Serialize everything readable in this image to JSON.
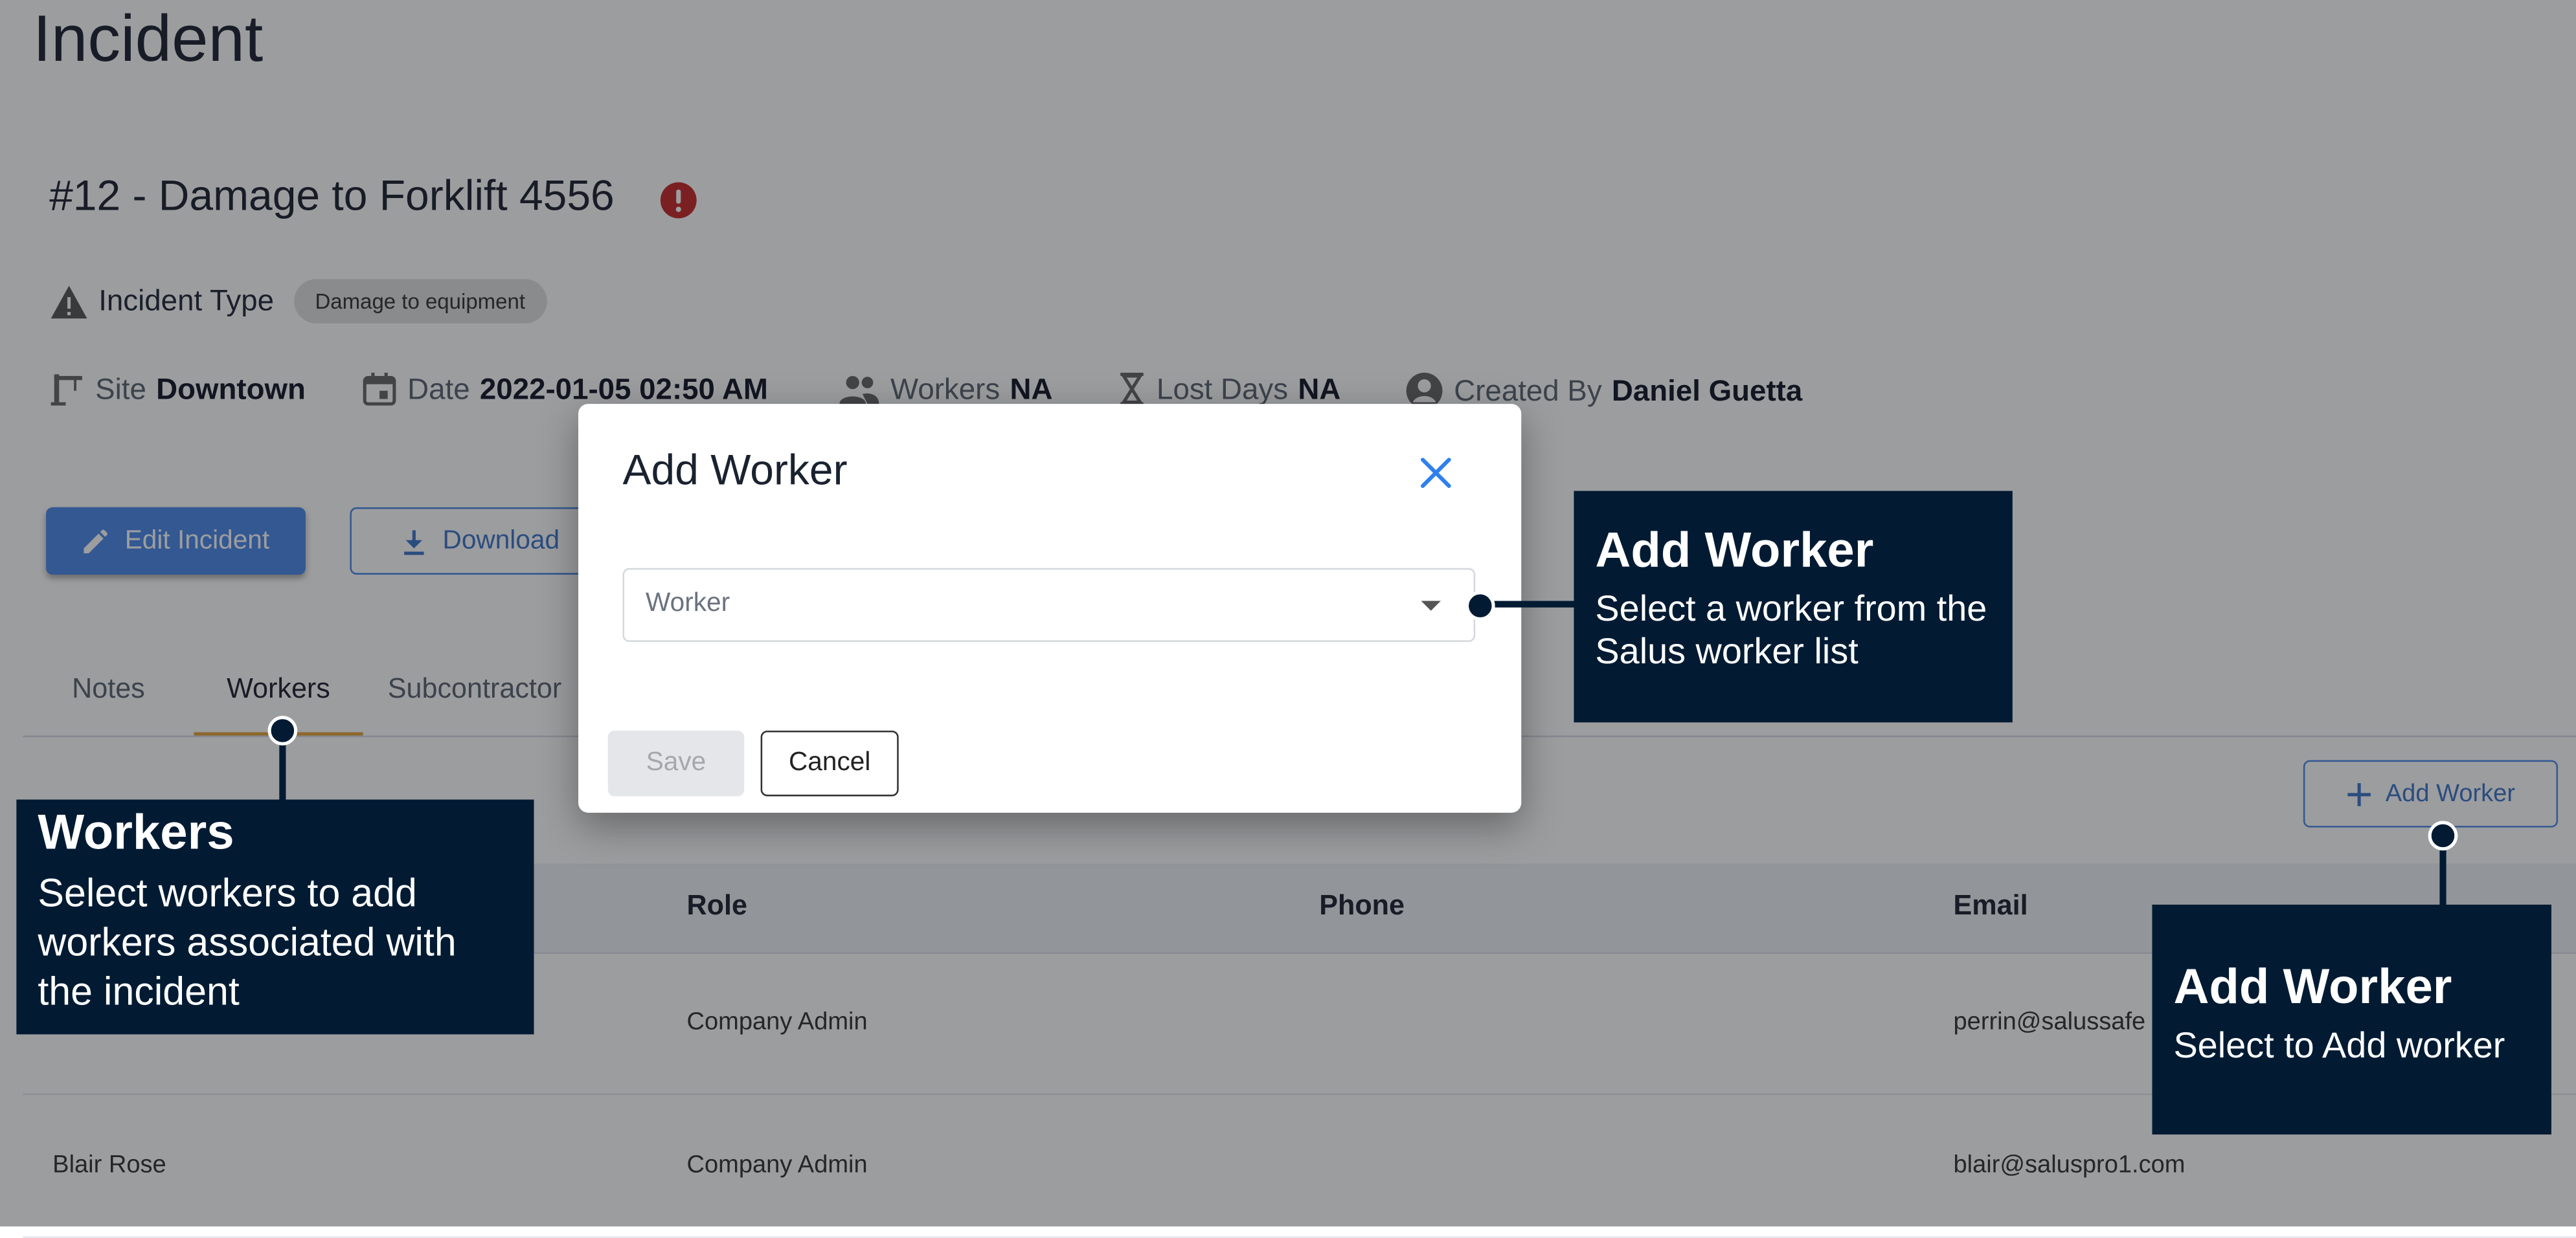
{
  "page": {
    "heading": "Incident"
  },
  "incident": {
    "title": "#12 - Damage to Forklift 4556",
    "type_label": "Incident Type",
    "type_value": "Damage to equipment",
    "meta": {
      "site_label": "Site",
      "site_value": "Downtown",
      "date_label": "Date",
      "date_value": "2022-01-05 02:50 AM",
      "workers_label": "Workers",
      "workers_value": "NA",
      "lost_days_label": "Lost Days",
      "lost_days_value": "NA",
      "created_by_label": "Created By",
      "created_by_value": "Daniel Guetta"
    }
  },
  "actions": {
    "edit_label": "Edit Incident",
    "download_label": "Download"
  },
  "tabs": [
    {
      "label": "Notes"
    },
    {
      "label": "Workers"
    },
    {
      "label": "Subcontractor"
    }
  ],
  "add_worker_button": "Add Worker",
  "table": {
    "columns": [
      "Role",
      "Phone",
      "Email"
    ],
    "rows": [
      {
        "name": "",
        "role": "Company Admin",
        "phone": "",
        "email": "perrin@salussafe"
      },
      {
        "name": "Blair Rose",
        "role": "Company Admin",
        "phone": "",
        "email": "blair@saluspro1.com"
      }
    ]
  },
  "modal": {
    "title": "Add Worker",
    "select_placeholder": "Worker",
    "save_label": "Save",
    "cancel_label": "Cancel"
  },
  "callouts": {
    "modal_select": {
      "title": "Add Worker",
      "body": "Select a worker from the Salus worker list"
    },
    "workers_tab": {
      "title": "Workers",
      "body": "Select workers to add workers associated with the incident"
    },
    "add_button": {
      "title": "Add Worker",
      "body": "Select to Add worker"
    }
  },
  "colors": {
    "primary": "#4a88e8",
    "tab_indicator": "#e3a43a",
    "alert": "#c62828",
    "callout_bg": "#021b33",
    "overlay": "rgba(20,22,26,0.42)"
  }
}
